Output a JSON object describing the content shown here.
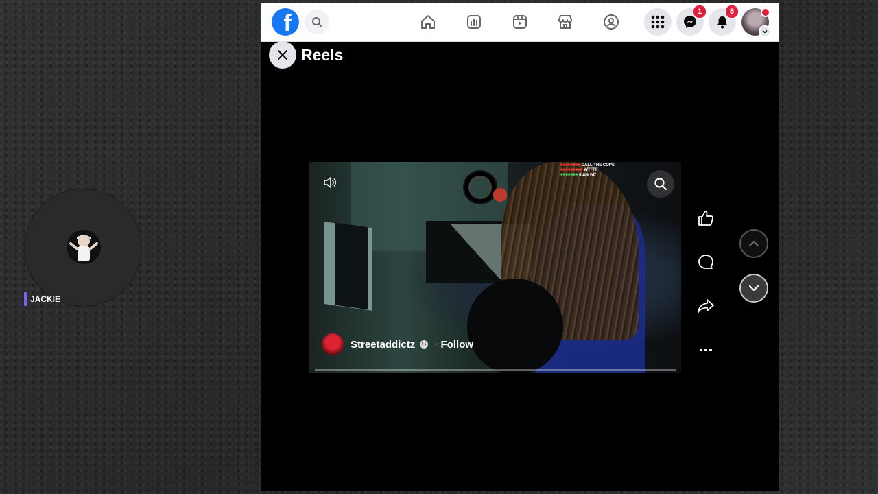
{
  "overlay": {
    "streamer_name": "JACKIE"
  },
  "topnav": {
    "logo": "f",
    "icons": [
      "home-icon",
      "insights-icon",
      "video-icon",
      "marketplace-icon",
      "groups-icon"
    ],
    "messenger_badge": "1",
    "notifications_badge": "5"
  },
  "reels": {
    "title": "Reels"
  },
  "video": {
    "creator_name": "Streetaddictz",
    "follow_label": "Follow",
    "chat_lines": [
      "CALL THE COPS",
      "WTFFF",
      "dude wtf"
    ],
    "progress": 0.0
  },
  "colors": {
    "brand": "#1877f2",
    "badge": "#e41e3f",
    "stream_accent": "#7b5cff"
  }
}
